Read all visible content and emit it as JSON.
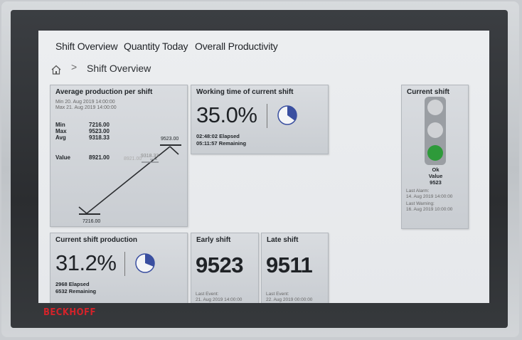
{
  "nav": {
    "tabs": [
      {
        "label": "Shift Overview"
      },
      {
        "label": "Quantity Today"
      },
      {
        "label": "Overall Productivity"
      }
    ]
  },
  "breadcrumb": {
    "separator": ">",
    "current": "Shift Overview"
  },
  "avg_production": {
    "title": "Average production per shift",
    "min_line": "Min  20. Aug 2019 14:00:00",
    "max_line": "Max  21. Aug 2019 14:00:00",
    "min_label": "Min",
    "min_value": "7216.00",
    "max_label": "Max",
    "max_value": "9523.00",
    "avg_label": "Avg",
    "avg_value": "9318.33",
    "value_label": "Value",
    "value_value": "8921.00",
    "chart_label_max": "9523.00",
    "chart_label_min": "7216.00",
    "chart_label_avg": "9318.33",
    "chart_label_value": "8921.00"
  },
  "working_time": {
    "title": "Working time of current shift",
    "percent": "35.0%",
    "fraction": 0.35,
    "elapsed": "02:48:02 Elapsed",
    "remaining": "05:11:57 Remaining"
  },
  "current_shift_production": {
    "title": "Current shift production",
    "percent": "31.2%",
    "fraction": 0.312,
    "elapsed": "2968 Elapsed",
    "remaining": "6532 Remaining"
  },
  "early_shift": {
    "title": "Early shift",
    "value": "9523",
    "event_label": "Last Event:",
    "event_time": "21. Aug 2019 14:00:00"
  },
  "late_shift": {
    "title": "Late shift",
    "value": "9511",
    "event_label": "Last Event:",
    "event_time": "22. Aug 2019 00:00:00"
  },
  "current_shift": {
    "title": "Current shift",
    "status": "Ok",
    "value_label": "Value",
    "value": "9523",
    "last_alarm_label": "Last Alarm:",
    "last_alarm_time": "14. Aug 2019 14:00:00",
    "last_warning_label": "Last Warning:",
    "last_warning_time": "16. Aug 2019 10:00:00",
    "lights": {
      "top": "#d0d2d5",
      "middle": "#d0d2d5",
      "bottom": "#2e9a3a"
    }
  },
  "colors": {
    "pie_fill": "#3a4fa0",
    "accent_red": "#d2232a"
  },
  "brand": {
    "logo": "BECKHOFF"
  }
}
